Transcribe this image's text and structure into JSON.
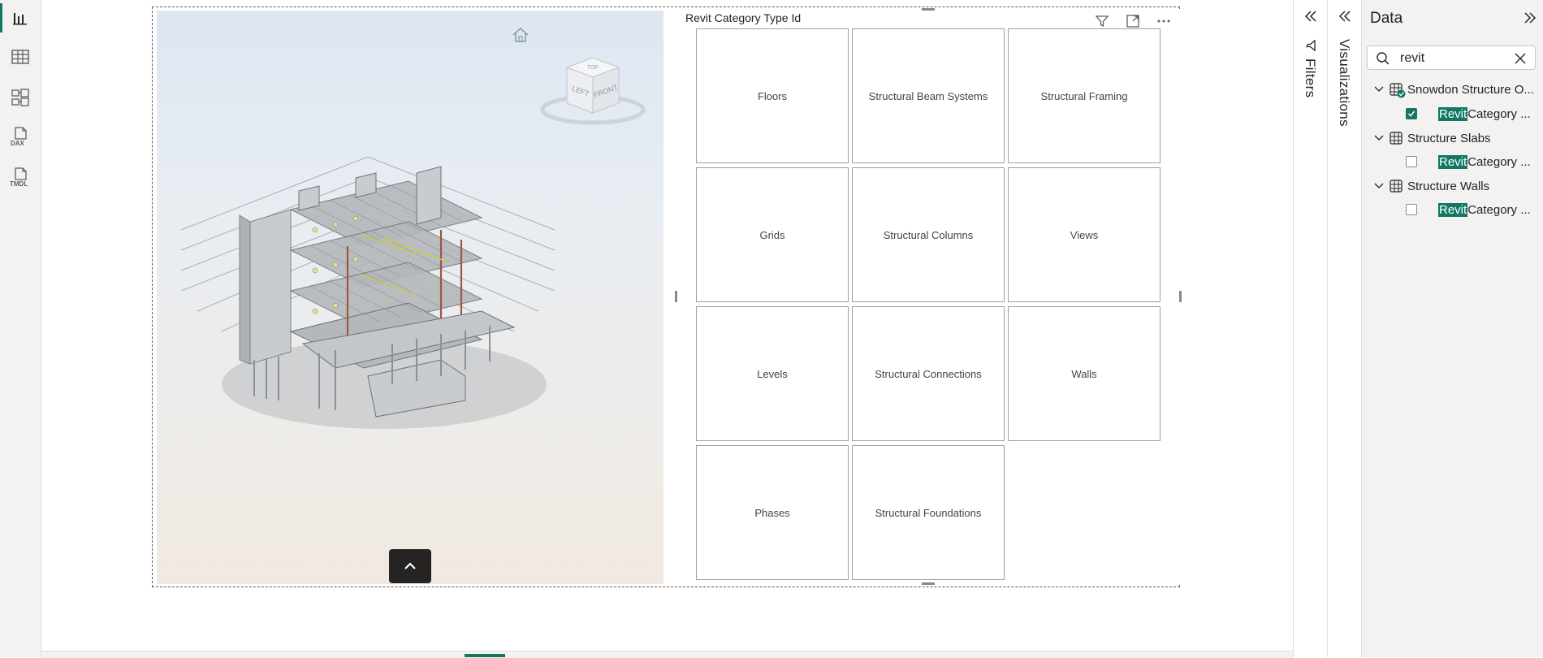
{
  "left_rail": {
    "items": [
      {
        "name": "report-view",
        "icon": "bar-chart-icon",
        "active": true
      },
      {
        "name": "table-view",
        "icon": "table-icon",
        "active": false
      },
      {
        "name": "model-view",
        "icon": "model-icon",
        "active": false
      },
      {
        "name": "dax-query-view",
        "icon": "dax-icon",
        "label": "DAX",
        "active": false
      },
      {
        "name": "tmdl-view",
        "icon": "tmdl-icon",
        "label": "TMDL",
        "active": false
      }
    ]
  },
  "viewer": {
    "cube_faces": {
      "top": "TOP",
      "left": "LEFT",
      "front": "FRONT"
    }
  },
  "slicer": {
    "title": "Revit Category Type Id",
    "tiles": [
      "Floors",
      "Structural Beam Systems",
      "Structural Framing",
      "Grids",
      "Structural Columns",
      "Views",
      "Levels",
      "Structural Connections",
      "Walls",
      "Phases",
      "Structural Foundations"
    ]
  },
  "panes": {
    "filters_label": "Filters",
    "visualizations_label": "Visualizations"
  },
  "data_pane": {
    "title": "Data",
    "search_value": "revit",
    "tables": [
      {
        "name": "Snowdon Structure O...",
        "field_highlight": "Revit",
        "field_rest": " Category ...",
        "checked": true
      },
      {
        "name": "Structure Slabs",
        "field_highlight": "Revit",
        "field_rest": " Category ...",
        "checked": false
      },
      {
        "name": "Structure Walls",
        "field_highlight": "Revit",
        "field_rest": " Category ...",
        "checked": false
      }
    ]
  },
  "colors": {
    "accent": "#117865",
    "border": "#a19f9d"
  }
}
